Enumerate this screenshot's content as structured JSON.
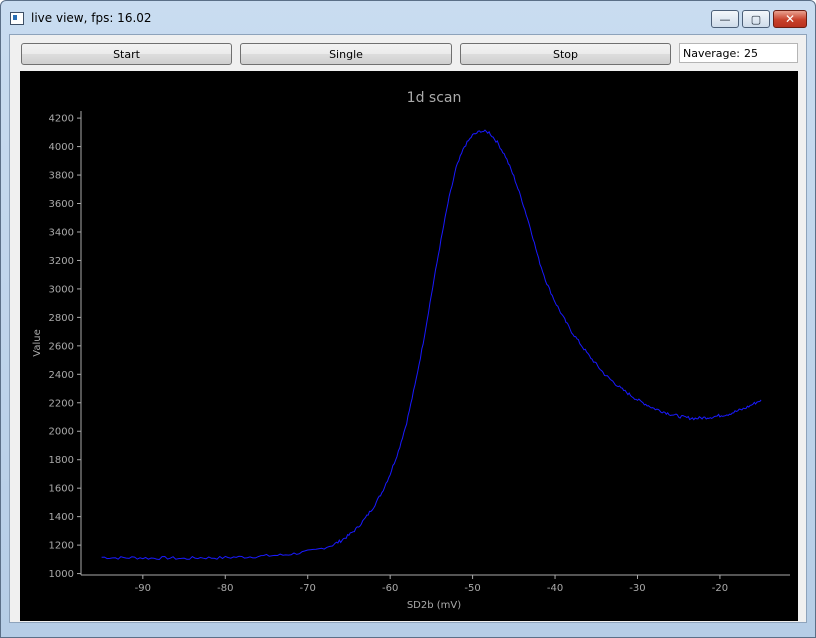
{
  "window": {
    "title": "live view, fps: 16.02",
    "minimize_glyph": "—",
    "maximize_glyph": "▢",
    "close_glyph": "✕"
  },
  "toolbar": {
    "start_label": "Start",
    "single_label": "Single",
    "stop_label": "Stop",
    "naverage_label": "Naverage:",
    "naverage_value": "25"
  },
  "chart_data": {
    "type": "line",
    "title": "1d scan",
    "xlabel": "SD2b (mV)",
    "ylabel": "Value",
    "xlim": [
      -97.5,
      -11.5
    ],
    "ylim": [
      990,
      4250
    ],
    "xticks": [
      -90,
      -80,
      -70,
      -60,
      -50,
      -40,
      -30,
      -20
    ],
    "yticks": [
      1000,
      1200,
      1400,
      1600,
      1800,
      2000,
      2200,
      2400,
      2600,
      2800,
      3000,
      3200,
      3400,
      3600,
      3800,
      4000,
      4200
    ],
    "grid": false,
    "line_color": "#1a1aff",
    "axis_color": "#aaaaaa",
    "series": [
      {
        "x": [
          -95,
          -93,
          -91,
          -89,
          -87,
          -85,
          -83,
          -81,
          -79,
          -77,
          -75,
          -73,
          -71,
          -69,
          -67,
          -66,
          -65,
          -64,
          -63,
          -62,
          -61,
          -60,
          -59,
          -58,
          -57,
          -56,
          -55,
          -54,
          -53,
          -52,
          -51,
          -50,
          -49,
          -48,
          -47,
          -46,
          -45,
          -44,
          -43,
          -42,
          -41,
          -40,
          -39,
          -38,
          -37,
          -36,
          -35,
          -34,
          -33,
          -32,
          -31,
          -30,
          -29,
          -28,
          -27,
          -26,
          -25,
          -24,
          -23,
          -22,
          -21,
          -20,
          -19,
          -18,
          -17,
          -16,
          -15
        ],
        "y": [
          1115,
          1110,
          1112,
          1108,
          1110,
          1105,
          1112,
          1110,
          1115,
          1118,
          1125,
          1130,
          1145,
          1165,
          1200,
          1230,
          1270,
          1320,
          1390,
          1470,
          1570,
          1700,
          1860,
          2060,
          2320,
          2620,
          2960,
          3290,
          3600,
          3850,
          4000,
          4080,
          4110,
          4100,
          4030,
          3930,
          3790,
          3620,
          3430,
          3210,
          3040,
          2910,
          2800,
          2700,
          2620,
          2540,
          2470,
          2400,
          2350,
          2300,
          2260,
          2220,
          2190,
          2160,
          2140,
          2120,
          2105,
          2095,
          2090,
          2095,
          2100,
          2110,
          2120,
          2140,
          2160,
          2190,
          2220
        ]
      }
    ]
  }
}
